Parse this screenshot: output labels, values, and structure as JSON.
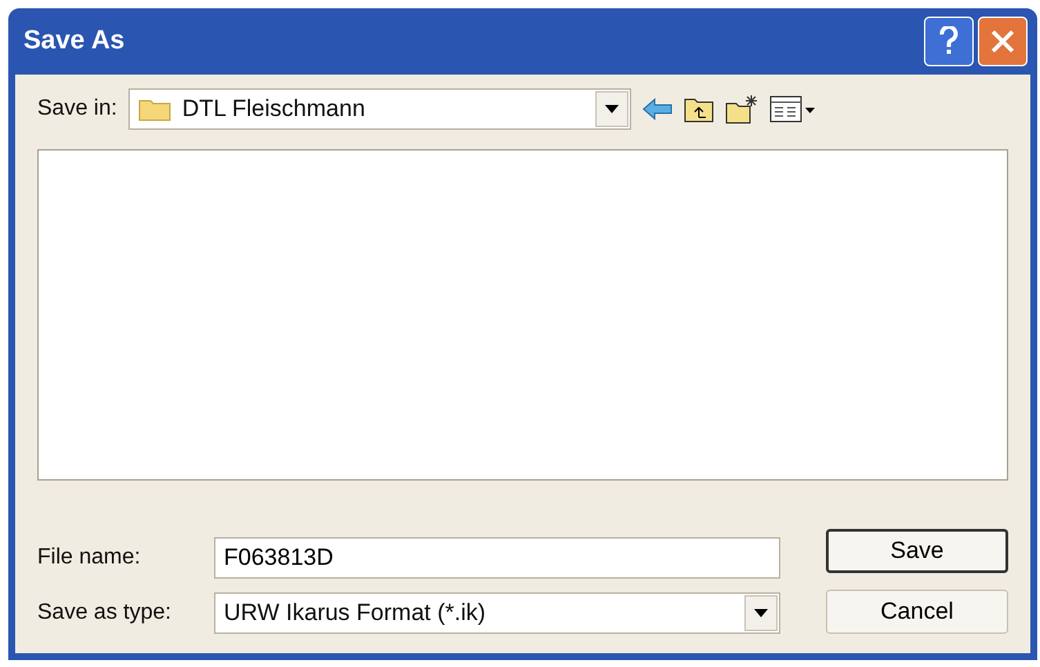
{
  "window": {
    "title": "Save As"
  },
  "save_in": {
    "label": "Save in:",
    "value": "DTL Fleischmann"
  },
  "file_name": {
    "label": "File name:",
    "value": "F063813D"
  },
  "save_as_type": {
    "label": "Save as type:",
    "value": "URW Ikarus Format (*.ik)"
  },
  "buttons": [
    {
      "label": "Save",
      "kind": "default"
    },
    {
      "label": "Cancel",
      "kind": "normal"
    }
  ]
}
